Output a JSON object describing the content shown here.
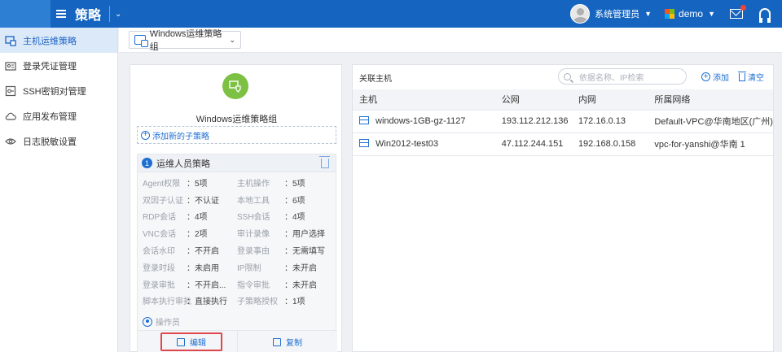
{
  "header": {
    "module_title": "策略",
    "user_name": "系统管理员",
    "tenant_name": "demo"
  },
  "sidebar": {
    "items": [
      {
        "label": "主机运维策略",
        "icon": "policy-icon",
        "active": true
      },
      {
        "label": "登录凭证管理",
        "icon": "credential-icon",
        "active": false
      },
      {
        "label": "SSH密钥对管理",
        "icon": "key-icon",
        "active": false
      },
      {
        "label": "应用发布管理",
        "icon": "cloud-icon",
        "active": false
      },
      {
        "label": "日志脱敏设置",
        "icon": "eye-icon",
        "active": false
      }
    ]
  },
  "toolbar": {
    "group_select_value": "Windows运维策略组"
  },
  "policy_group": {
    "name": "Windows运维策略组",
    "add_sub_label": "添加新的子策略",
    "sub_policy": {
      "index": "1",
      "title": "运维人员策略",
      "attributes": [
        {
          "k1": "Agent权限",
          "v1": "：5项",
          "k2": "主机操作",
          "v2": "：5项"
        },
        {
          "k1": "双因子认证",
          "v1": "：不认证",
          "k2": "本地工具",
          "v2": "：6项"
        },
        {
          "k1": "RDP会话",
          "v1": "：4项",
          "k2": "SSH会话",
          "v2": "：4项"
        },
        {
          "k1": "VNC会话",
          "v1": "：2项",
          "k2": "审计录像",
          "v2": "：用户选择"
        },
        {
          "k1": "会话水印",
          "v1": "：不开启",
          "k2": "登录事由",
          "v2": "：无需填写"
        },
        {
          "k1": "登录时段",
          "v1": "：未启用",
          "k2": "IP限制",
          "v2": "：未开启"
        },
        {
          "k1": "登录审批",
          "v1": "：不开启...",
          "k2": "指令审批",
          "v2": "：未开启"
        },
        {
          "k1": "脚本执行审批",
          "v1": "：直接执行",
          "k2": "子策略授权",
          "v2": "：1项"
        }
      ],
      "operator_label": "操作员",
      "edit_label": "编辑",
      "copy_label": "复制"
    }
  },
  "hosts": {
    "title": "关联主机",
    "search_placeholder": "依据名称、IP检索",
    "add_label": "添加",
    "clear_label": "清空",
    "columns": [
      "主机",
      "公网",
      "内网",
      "所属网络"
    ],
    "rows": [
      {
        "host": "windows-1GB-gz-1127",
        "public_ip": "193.112.212.136",
        "private_ip": "172.16.0.13",
        "network": "Default-VPC@华南地区(广州)"
      },
      {
        "host": "Win2012-test03",
        "public_ip": "47.112.244.151",
        "private_ip": "192.168.0.158",
        "network": "vpc-for-yanshi@华南 1"
      }
    ]
  },
  "colors": {
    "topbar": "#1565c0",
    "accent": "#1f6fd1",
    "shield_green": "#7cc143",
    "highlight_red": "#e0474c"
  }
}
